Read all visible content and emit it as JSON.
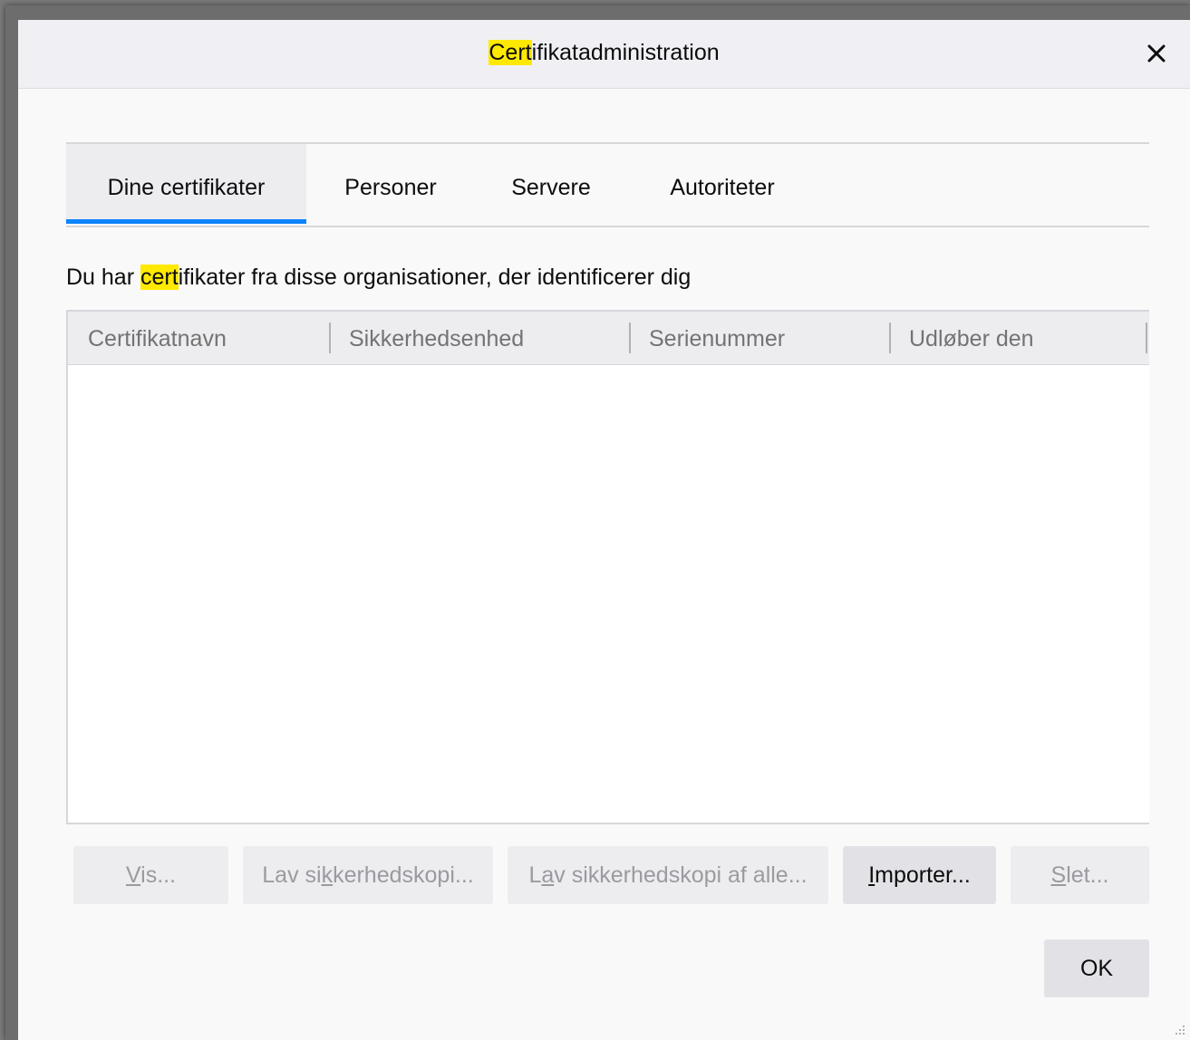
{
  "dialog": {
    "title_highlight": "Cert",
    "title_rest": "ifikatadministration"
  },
  "tabs": [
    {
      "label": "Dine certifikater",
      "active": true
    },
    {
      "label": "Personer",
      "active": false
    },
    {
      "label": "Servere",
      "active": false
    },
    {
      "label": "Autoriteter",
      "active": false
    }
  ],
  "description": {
    "before": "Du har ",
    "highlight": "cert",
    "after": "ifikater fra disse organisationer, der identificerer dig"
  },
  "table": {
    "columns": [
      "Certifikatnavn",
      "Sikkerhedsenhed",
      "Serienummer",
      "Udløber den"
    ],
    "rows": []
  },
  "buttons": {
    "view": {
      "pre": "",
      "accel": "V",
      "post": "is...",
      "enabled": false
    },
    "backup": {
      "pre": "Lav si",
      "accel": "k",
      "post": "kerhedskopi...",
      "enabled": false
    },
    "backup_all": {
      "pre": "L",
      "accel": "a",
      "post": "v sikkerhedskopi af alle...",
      "enabled": false
    },
    "import": {
      "pre": "",
      "accel": "I",
      "post": "mporter...",
      "enabled": true
    },
    "delete": {
      "pre": "",
      "accel": "S",
      "post": "let...",
      "enabled": false
    },
    "ok": {
      "label": "OK"
    }
  },
  "colors": {
    "highlight": "#ffe900",
    "tab_underline": "#0a84ff"
  },
  "icons": {
    "close": "close-icon",
    "resize": "resize-grip-icon"
  }
}
